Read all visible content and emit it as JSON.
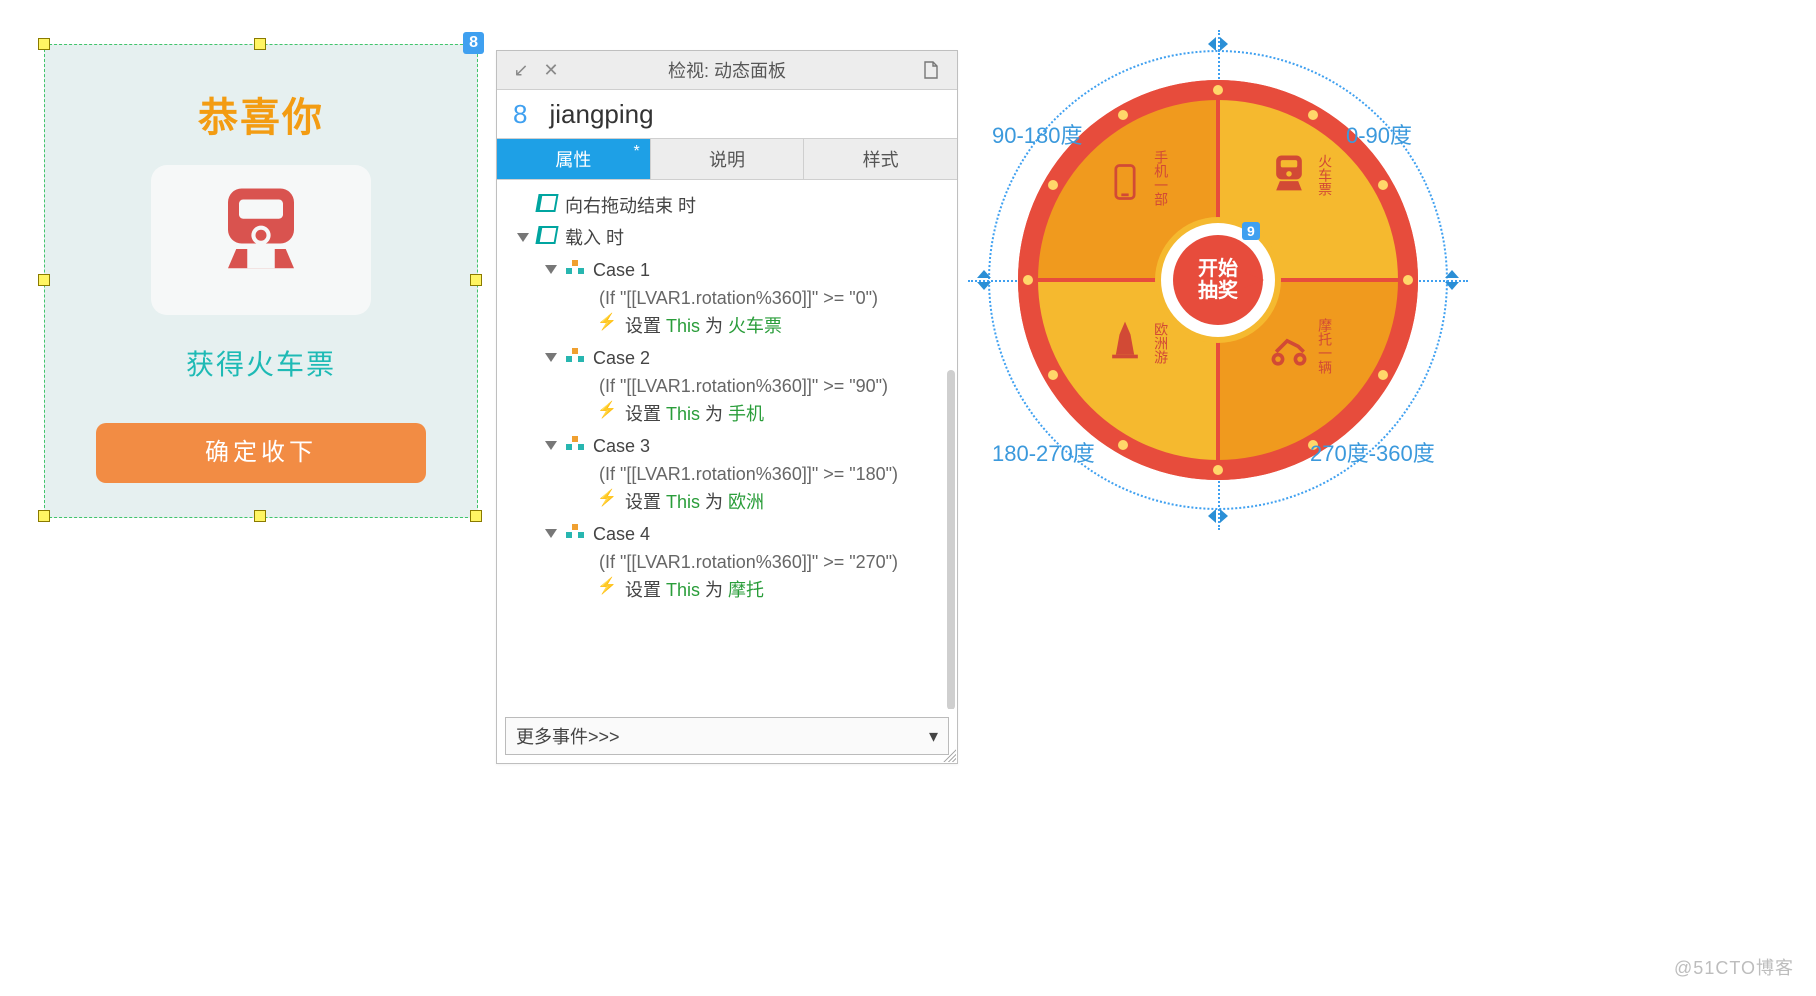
{
  "prize": {
    "title": "恭喜你",
    "result_label": "获得火车票",
    "confirm_label": "确定收下",
    "badge": "8"
  },
  "inspector": {
    "window_title": "检视: 动态面板",
    "index": "8",
    "name": "jiangping",
    "tabs": {
      "props": "属性",
      "desc": "说明",
      "style": "样式"
    },
    "events": {
      "drag_end": "向右拖动结束 时",
      "on_load": "载入 时"
    },
    "cases": [
      {
        "title": "Case 1",
        "cond": "(If \"[[LVAR1.rotation%360]]\" >= \"0\")",
        "action_prefix": "设置 ",
        "action_this": "This",
        "action_mid": " 为 ",
        "action_target": "火车票"
      },
      {
        "title": "Case 2",
        "cond": "(If \"[[LVAR1.rotation%360]]\" >= \"90\")",
        "action_prefix": "设置 ",
        "action_this": "This",
        "action_mid": " 为 ",
        "action_target": "手机"
      },
      {
        "title": "Case 3",
        "cond": "(If \"[[LVAR1.rotation%360]]\" >= \"180\")",
        "action_prefix": "设置 ",
        "action_this": "This",
        "action_mid": " 为 ",
        "action_target": "欧洲"
      },
      {
        "title": "Case 4",
        "cond": "(If \"[[LVAR1.rotation%360]]\" >= \"270\")",
        "action_prefix": "设置 ",
        "action_this": "This",
        "action_mid": " 为 ",
        "action_target": "摩托"
      }
    ],
    "more_events": "更多事件>>>"
  },
  "wheel": {
    "center_line1": "开始",
    "center_line2": "抽奖",
    "badge": "9",
    "angles": {
      "tr": "0-90度",
      "tl": "90-180度",
      "bl": "180-270度",
      "br": "270度-360度"
    },
    "sectors": {
      "tr": "火车票",
      "tl": "手机一部",
      "bl": "欧洲游",
      "br": "摩托一辆"
    }
  },
  "watermark": "@51CTO博客"
}
